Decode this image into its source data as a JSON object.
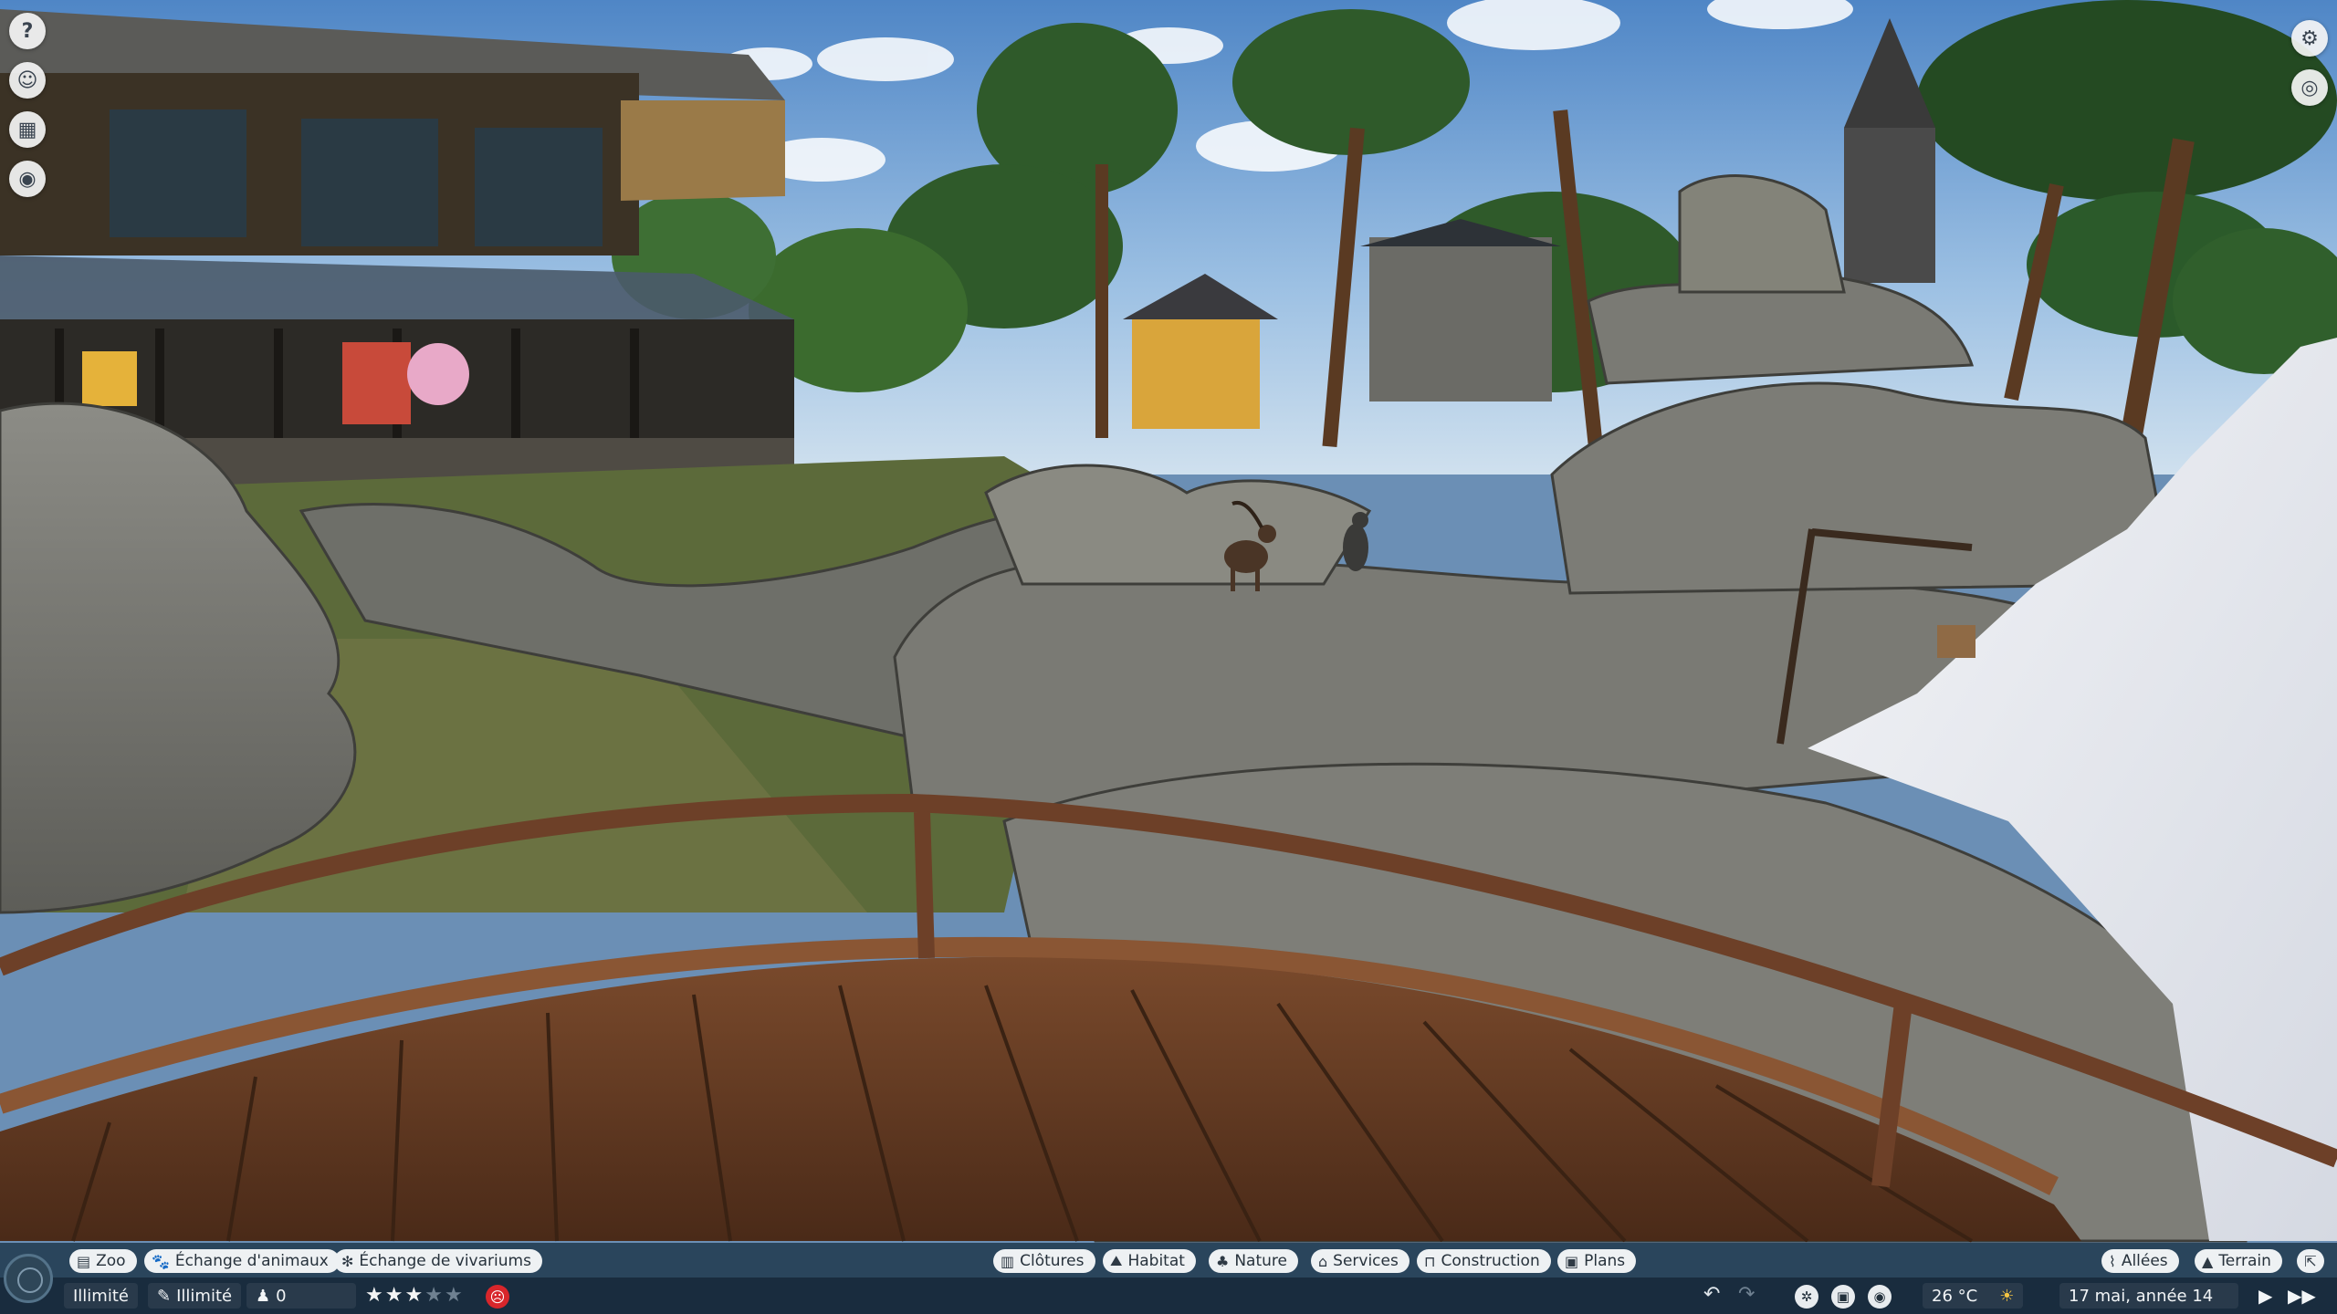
{
  "left_toolbar": [
    {
      "name": "help-icon",
      "glyph": "?"
    },
    {
      "name": "staff-icon",
      "glyph": "☺"
    },
    {
      "name": "calendar-icon",
      "glyph": "▦"
    },
    {
      "name": "view-icon",
      "glyph": "◉"
    }
  ],
  "right_toolbar": [
    {
      "name": "settings-icon",
      "glyph": "⚙"
    },
    {
      "name": "camera-view-icon",
      "glyph": "◎"
    }
  ],
  "top_bar": {
    "left_buttons": [
      {
        "name": "zoo-button",
        "icon": "▤",
        "label": "Zoo"
      },
      {
        "name": "animal-exchange-button",
        "icon": "🐾",
        "label": "Échange d'animaux"
      },
      {
        "name": "vivarium-exchange-button",
        "icon": "✻",
        "label": "Échange de vivariums"
      }
    ],
    "center_buttons": [
      {
        "name": "fences-button",
        "icon": "▥",
        "label": "Clôtures"
      },
      {
        "name": "habitat-button",
        "icon": "⛰",
        "label": "Habitat"
      },
      {
        "name": "nature-button",
        "icon": "♣",
        "label": "Nature"
      },
      {
        "name": "services-button",
        "icon": "⌂",
        "label": "Services"
      },
      {
        "name": "construction-button",
        "icon": "⊓",
        "label": "Construction"
      },
      {
        "name": "plans-button",
        "icon": "▣",
        "label": "Plans"
      }
    ],
    "right_buttons": [
      {
        "name": "paths-button",
        "icon": "⌇",
        "label": "Allées"
      },
      {
        "name": "terrain-button",
        "icon": "▲",
        "label": "Terrain"
      }
    ]
  },
  "bottom_bar": {
    "money": "Illimité",
    "research": {
      "icon": "✎",
      "label": "Illimité"
    },
    "guests": {
      "icon": "♟",
      "count": "0"
    },
    "rating": {
      "filled": 3,
      "total": 5
    },
    "undo_glyph": "↶",
    "redo_glyph": "↷",
    "temperature": "26 °C",
    "weather_glyph": "☀",
    "date": "17 mai, année 14",
    "play_glyph": "▶",
    "fast_glyph": "▶▶"
  },
  "colors": {
    "hud_top": "#1c3448",
    "hud_bottom": "#122434",
    "pill_bg": "#eef1f3",
    "alert_red": "#d8262b"
  }
}
